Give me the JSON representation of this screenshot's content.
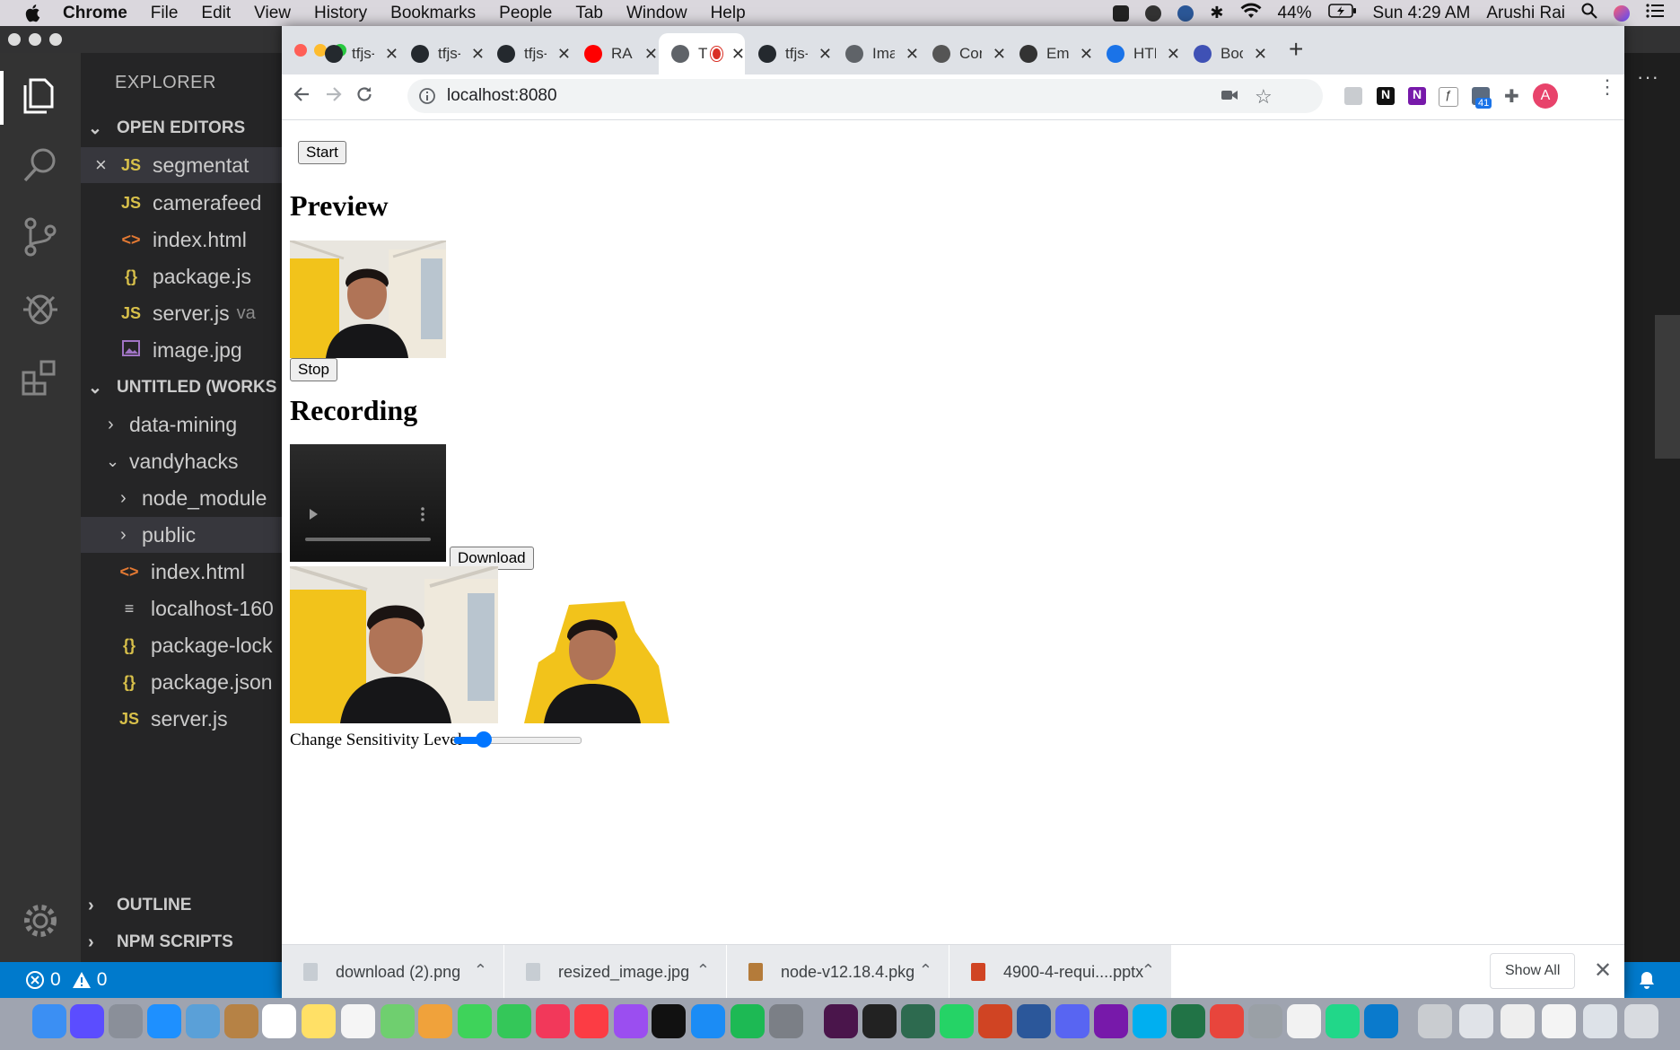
{
  "menubar": {
    "app": "Chrome",
    "menus": [
      "File",
      "Edit",
      "View",
      "History",
      "Bookmarks",
      "People",
      "Tab",
      "Window",
      "Help"
    ],
    "battery": "44%",
    "clock": "Sun 4:29 AM",
    "user": "Arushi Rai"
  },
  "vscode": {
    "explorer_title": "EXPLORER",
    "open_editors_label": "OPEN EDITORS",
    "workspace_label": "UNTITLED (WORKS",
    "open_editors": [
      {
        "badge": "JS",
        "name": "segmentat",
        "kind": "js"
      },
      {
        "badge": "JS",
        "name": "camerafeed",
        "kind": "js"
      },
      {
        "badge": "<>",
        "name": "index.html",
        "kind": "html"
      },
      {
        "badge": "{}",
        "name": "package.js",
        "kind": "json"
      },
      {
        "badge": "JS",
        "name": "server.js",
        "kind": "js",
        "extra": "va"
      },
      {
        "badge": "img",
        "name": "image.jpg",
        "kind": "img"
      }
    ],
    "tree": [
      {
        "name": "data-mining"
      },
      {
        "name": "vandyhacks"
      },
      {
        "name": "node_module"
      },
      {
        "name": "public"
      },
      {
        "badge": "<>",
        "name": "index.html"
      },
      {
        "badge": "≡",
        "name": "localhost-160"
      },
      {
        "badge": "{}",
        "name": "package-lock"
      },
      {
        "badge": "{}",
        "name": "package.json"
      },
      {
        "badge": "JS",
        "name": "server.js"
      }
    ],
    "outline_label": "OUTLINE",
    "npm_label": "NPM SCRIPTS",
    "status_errors": "0",
    "status_warnings": "0"
  },
  "chrome": {
    "tabs": [
      {
        "title": "tfjs-",
        "color": "#24292e"
      },
      {
        "title": "tfjs-",
        "color": "#24292e"
      },
      {
        "title": "tfjs-",
        "color": "#24292e"
      },
      {
        "title": "RAIN",
        "color": "#ff0000"
      },
      {
        "title": "T",
        "color": "#5f6368",
        "active": true
      },
      {
        "title": "tfjs-",
        "color": "#24292e"
      },
      {
        "title": "Imag",
        "color": "#5f6368"
      },
      {
        "title": "Conv",
        "color": "#555555"
      },
      {
        "title": "Emit",
        "color": "#333333"
      },
      {
        "title": "HTM",
        "color": "#1a73e8"
      },
      {
        "title": "Boot",
        "color": "#3f51b5"
      }
    ],
    "url": "localhost:8080",
    "profile_initial": "A",
    "ext_badge": "41"
  },
  "page": {
    "start_label": "Start",
    "preview_heading": "Preview",
    "stop_label": "Stop",
    "recording_heading": "Recording",
    "download_label": "Download",
    "sensitivity_label": "Change Sensitivity Level",
    "sensitivity_value": 0.2
  },
  "downloads": {
    "items": [
      {
        "name": "download (2).png"
      },
      {
        "name": "resized_image.jpg"
      },
      {
        "name": "node-v12.18.4.pkg"
      },
      {
        "name": "4900-4-requi....pptx"
      }
    ],
    "show_all": "Show All"
  }
}
